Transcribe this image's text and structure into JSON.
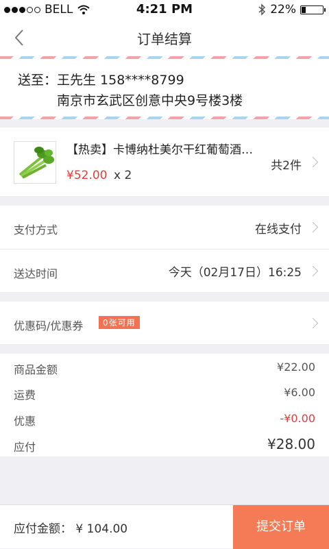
{
  "status_bar": {
    "carrier": "BELL",
    "time": "4:21 PM",
    "battery": "22%",
    "battery_level": 0.22,
    "signal_bars": 3,
    "signal_total": 5,
    "icons": [
      "wifi-icon",
      "bluetooth-icon",
      "battery-icon"
    ]
  },
  "nav": {
    "title": "订单结算",
    "back_icon": "chevron-left-icon"
  },
  "address": {
    "line1": "送至：王先生 158****8799",
    "line2": "南京市玄武区创意中央9号楼3楼"
  },
  "product": {
    "name": "【热卖】卡博纳杜美尔干红葡萄酒…",
    "price": "¥52.00",
    "qty": "x 2",
    "count": "共2件",
    "thumb_icon": "celery-image"
  },
  "payment": {
    "label": "支付方式",
    "value": "在线支付"
  },
  "delivery": {
    "label": "送达时间",
    "value": "今天（02月17日）16:25"
  },
  "coupon": {
    "label": "优惠码/优惠券",
    "badge": "0张可用"
  },
  "summary": {
    "rows": [
      {
        "label": "商品金额",
        "value": "¥22.00"
      },
      {
        "label": "运费",
        "value": "¥6.00"
      },
      {
        "label": "优惠",
        "value": "-¥0.00"
      },
      {
        "label": "应付",
        "value": "¥28.00"
      }
    ]
  },
  "bottom": {
    "total": "应付金额： ¥ 104.00",
    "submit_label": "提交订单"
  },
  "colors": {
    "accent": "#f47b56",
    "price_red": "#e43d3d",
    "badge": "#f27252"
  }
}
